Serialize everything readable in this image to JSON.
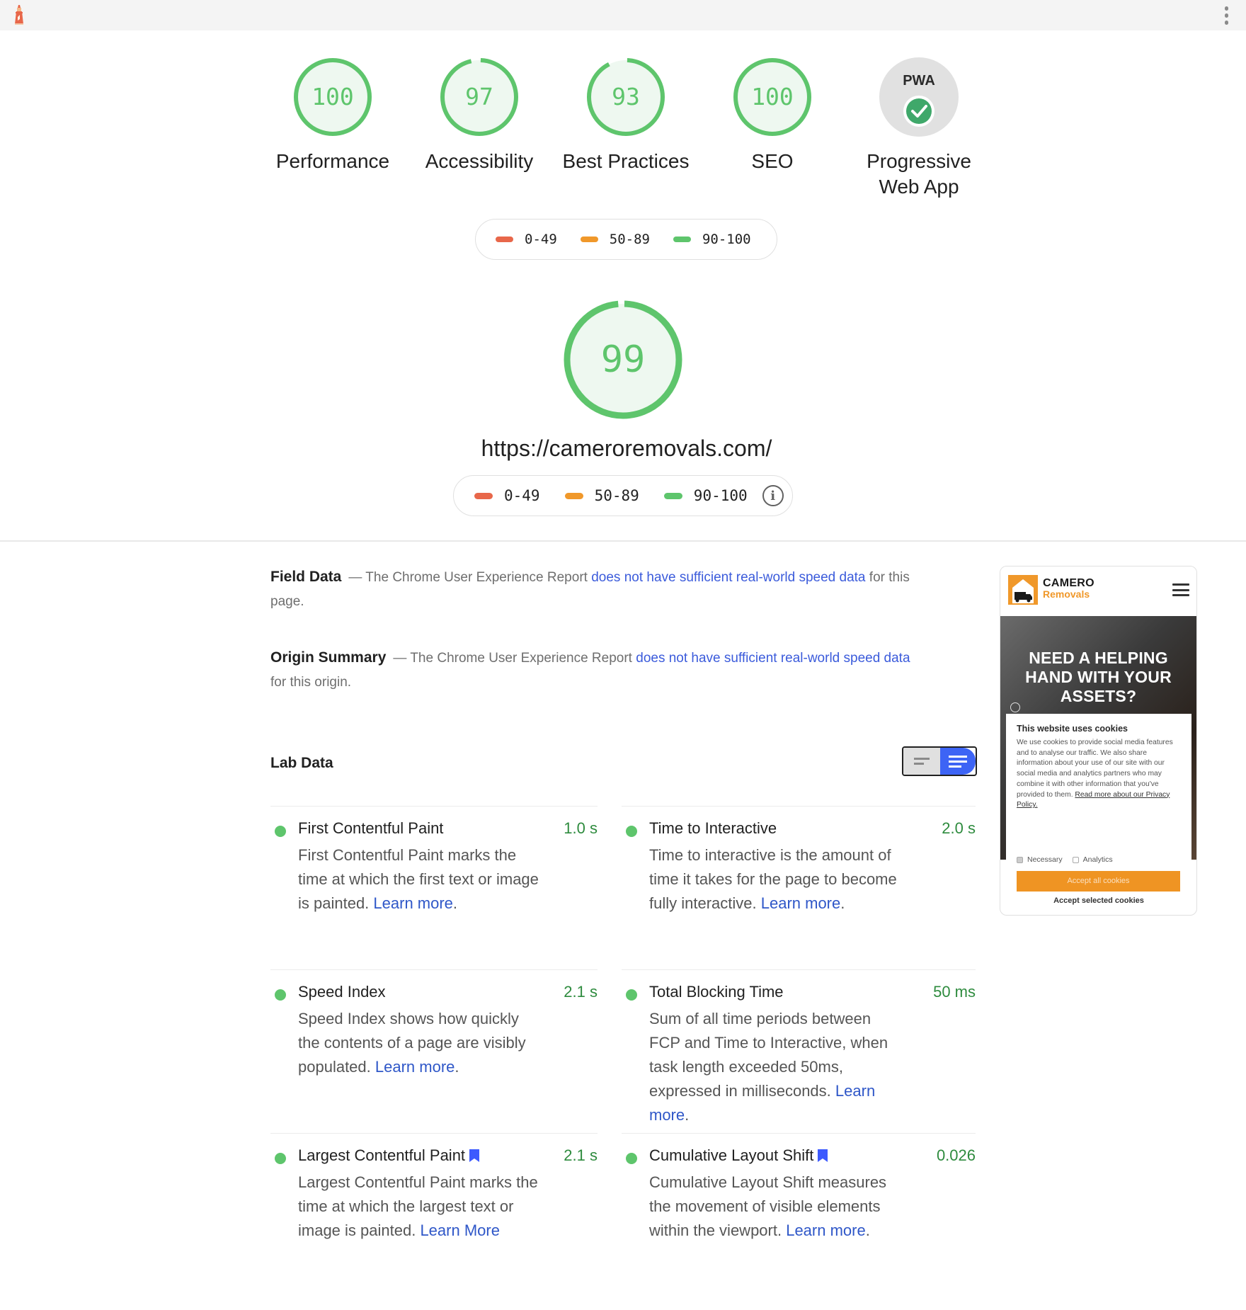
{
  "topbar": {
    "logo_icon": "lighthouse-icon",
    "menu_icon": "more-vert-icon"
  },
  "colors": {
    "pass": "#5ec56c",
    "pass_fill": "#eef8f0",
    "average": "#f0982a",
    "fail": "#e8674a",
    "link": "#3b5bdb",
    "metric_value": "#2e8b3e",
    "toggle_active": "#3d64f5",
    "bookmark": "#3d5afe"
  },
  "categories": [
    {
      "label": "Performance",
      "score": "100",
      "fraction": 1.0
    },
    {
      "label": "Accessibility",
      "score": "97",
      "fraction": 0.97
    },
    {
      "label": "Best Practices",
      "score": "93",
      "fraction": 0.93
    },
    {
      "label": "SEO",
      "score": "100",
      "fraction": 1.0
    },
    {
      "label_line1": "Progressive",
      "label_line2": "Web App",
      "badge_text": "PWA",
      "badge_icon": "check-circle-icon"
    }
  ],
  "legend": {
    "ranges": [
      "0-49",
      "50-89",
      "90-100"
    ],
    "info_icon": "info-icon"
  },
  "summary": {
    "score": "99",
    "fraction": 0.99,
    "url": "https://cameroremovals.com/"
  },
  "field_data": {
    "title": "Field Data",
    "prefix": "— The Chrome User Experience Report ",
    "link": "does not have sufficient real-world speed data",
    "suffix": " for this page."
  },
  "origin_summary": {
    "title": "Origin Summary",
    "prefix": "— The Chrome User Experience Report ",
    "link": "does not have sufficient real-world speed data",
    "suffix": " for this origin."
  },
  "lab_data": {
    "title": "Lab Data",
    "toggle": {
      "options": [
        "compact-view",
        "expanded-view"
      ],
      "active": "expanded-view"
    },
    "metrics": [
      {
        "name": "First Contentful Paint",
        "value": "1.0 s",
        "desc": "First Contentful Paint marks the time at which the first text or image is painted. ",
        "link": "Learn more",
        "after": ".",
        "core_web_vital": false
      },
      {
        "name": "Time to Interactive",
        "value": "2.0 s",
        "desc": "Time to interactive is the amount of time it takes for the page to become fully interactive. ",
        "link": "Learn more",
        "after": ".",
        "core_web_vital": false
      },
      {
        "name": "Speed Index",
        "value": "2.1 s",
        "desc": "Speed Index shows how quickly the contents of a page are visibly populated. ",
        "link": "Learn more",
        "after": ".",
        "core_web_vital": false
      },
      {
        "name": "Total Blocking Time",
        "value": "50 ms",
        "desc": "Sum of all time periods between FCP and Time to Interactive, when task length exceeded 50ms, expressed in milliseconds. ",
        "link": "Learn more",
        "after": ".",
        "core_web_vital": false
      },
      {
        "name": "Largest Contentful Paint",
        "value": "2.1 s",
        "desc": "Largest Contentful Paint marks the time at which the largest text or image is painted. ",
        "link": "Learn More",
        "after": "",
        "core_web_vital": true
      },
      {
        "name": "Cumulative Layout Shift",
        "value": "0.026",
        "desc": "Cumulative Layout Shift measures the movement of visible elements within the viewport. ",
        "link": "Learn more",
        "after": ".",
        "core_web_vital": true
      }
    ]
  },
  "screenshot": {
    "brand_line1": "CAMERO",
    "brand_line2": "Removals",
    "hero_line1": "NEED A HELPING",
    "hero_line2": "HAND WITH YOUR",
    "hero_line3": "ASSETS?",
    "cookie_title": "This website uses cookies",
    "cookie_body": "We use cookies to provide social media features and to analyse our traffic. We also share information about your use of our site with our social media and analytics partners who may combine it with other information that you've provided to them. ",
    "cookie_link": "Read more about our Privacy Policy.",
    "opt_necessary": "Necessary",
    "opt_analytics": "Analytics",
    "accept_all": "Accept all cookies",
    "accept_selected": "Accept selected cookies"
  }
}
